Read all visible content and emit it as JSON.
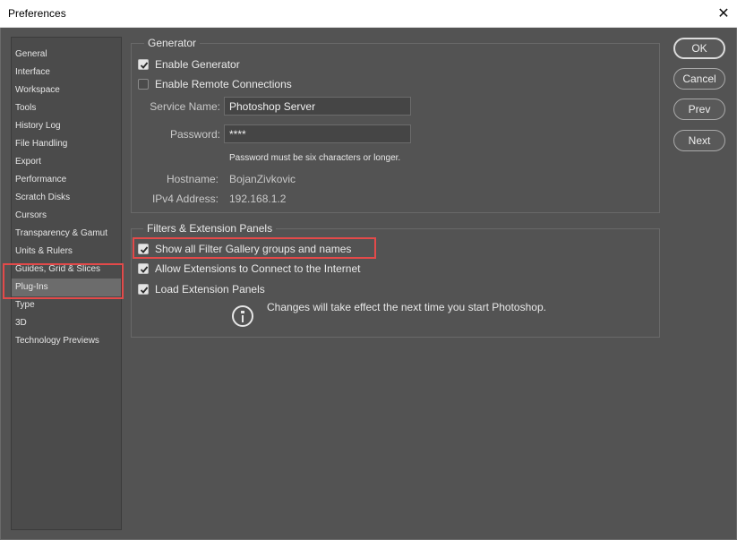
{
  "window": {
    "title": "Preferences",
    "close_glyph": "✕"
  },
  "sidebar": {
    "items": [
      {
        "label": "General"
      },
      {
        "label": "Interface"
      },
      {
        "label": "Workspace"
      },
      {
        "label": "Tools"
      },
      {
        "label": "History Log"
      },
      {
        "label": "File Handling"
      },
      {
        "label": "Export"
      },
      {
        "label": "Performance"
      },
      {
        "label": "Scratch Disks"
      },
      {
        "label": "Cursors"
      },
      {
        "label": "Transparency & Gamut"
      },
      {
        "label": "Units & Rulers"
      },
      {
        "label": "Guides, Grid & Slices"
      },
      {
        "label": "Plug-Ins",
        "selected": true
      },
      {
        "label": "Type"
      },
      {
        "label": "3D"
      },
      {
        "label": "Technology Previews"
      }
    ]
  },
  "generator": {
    "legend": "Generator",
    "enable_generator": {
      "label": "Enable Generator",
      "checked": true
    },
    "enable_remote": {
      "label": "Enable Remote Connections",
      "checked": false
    },
    "service_name": {
      "label": "Service Name:",
      "value": "Photoshop Server"
    },
    "password": {
      "label": "Password:",
      "value": "****"
    },
    "password_hint": "Password must be six characters or longer.",
    "hostname": {
      "label": "Hostname:",
      "value": "BojanZivkovic"
    },
    "ipv4": {
      "label": "IPv4 Address:",
      "value": "192.168.1.2"
    }
  },
  "filters": {
    "legend": "Filters & Extension Panels",
    "show_filter_gallery": {
      "label": "Show all Filter Gallery groups and names",
      "checked": true
    },
    "allow_extensions": {
      "label": "Allow Extensions to Connect to the Internet",
      "checked": true
    },
    "load_panels": {
      "label": "Load Extension Panels",
      "checked": true
    },
    "notice": "Changes will take effect the next time you start Photoshop."
  },
  "buttons": {
    "ok": "OK",
    "cancel": "Cancel",
    "prev": "Prev",
    "next": "Next"
  },
  "colors": {
    "background": "#535353",
    "highlight": "#e34a4a",
    "selected_item": "#6c6c6c"
  },
  "icons": {
    "close": "close-icon",
    "check": "check-icon",
    "info": "info-icon"
  }
}
